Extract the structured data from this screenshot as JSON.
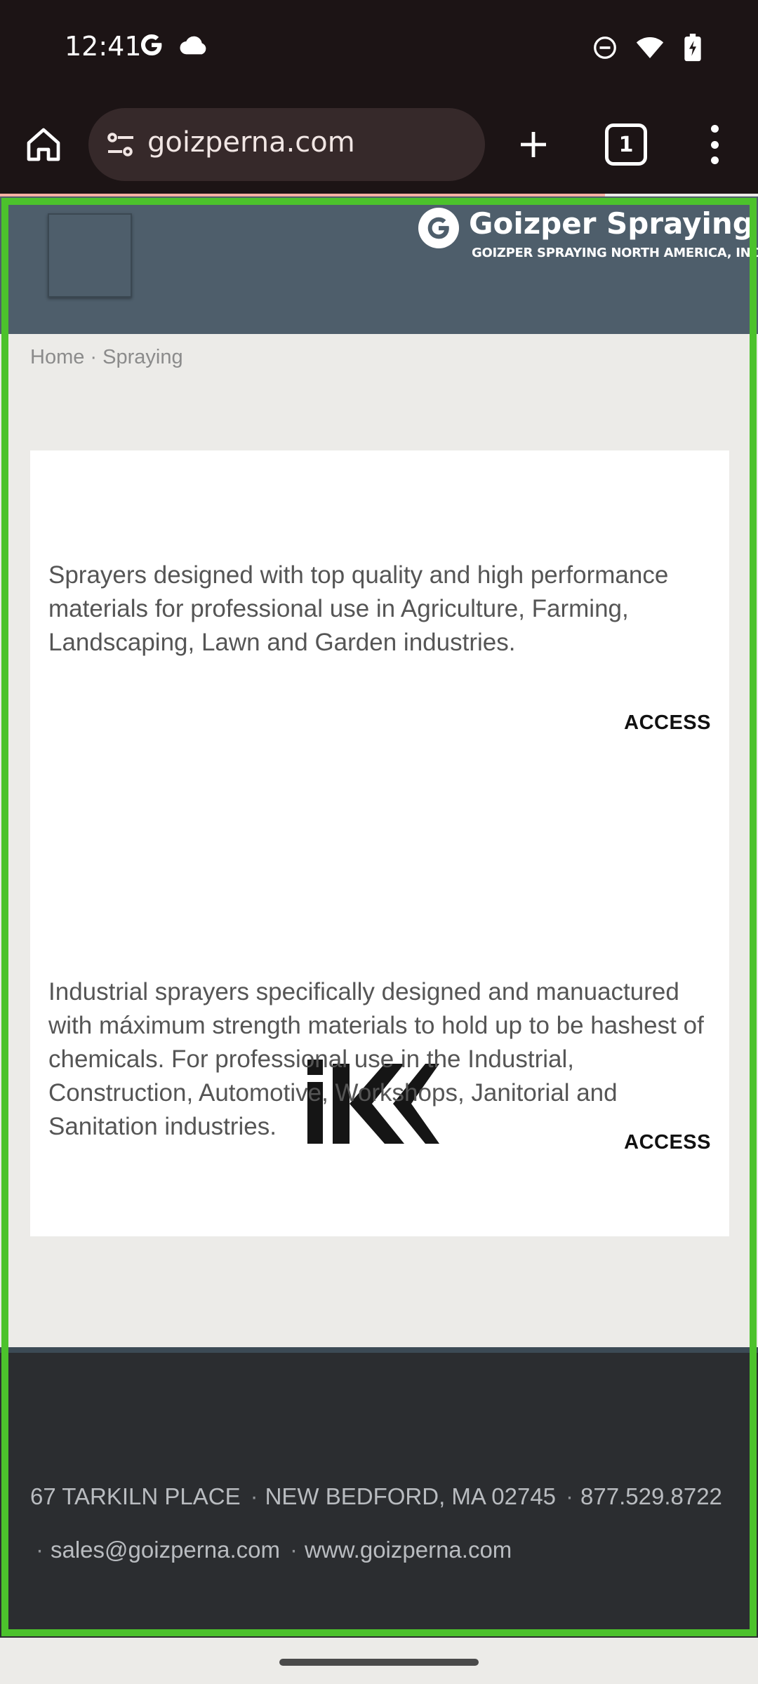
{
  "status_bar": {
    "time": "12:41",
    "left_icons": [
      "google-icon",
      "cloud-icon"
    ],
    "right_icons": [
      "do-not-disturb-icon",
      "wifi-icon",
      "battery-icon"
    ]
  },
  "browser": {
    "url": "goizperna.com",
    "tab_count": "1",
    "icons": [
      "home-icon",
      "site-settings-icon",
      "new-tab-icon",
      "tab-switcher-icon",
      "more-menu-icon"
    ]
  },
  "header": {
    "logo_title": "Goizper Spraying",
    "logo_subtitle": "GOIZPER SPRAYING NORTH AMERICA, INC."
  },
  "breadcrumb": {
    "home": "Home",
    "separator": "·",
    "current": "Spraying"
  },
  "products": [
    {
      "description": "Sprayers designed with top quality and high performance materials for professional use in Agriculture, Farming, Landscaping, Lawn and Garden industries.",
      "access_label": "ACCESS"
    },
    {
      "logo_text": "iK",
      "description": "Industrial sprayers specifically designed and manuactured with máximum strength materials to hold up to be hashest of chemicals. For professional use in the Industrial, Construction, Automotive, Workshops, Janitorial and Sanitation industries.",
      "access_label": "ACCESS"
    }
  ],
  "footer": {
    "address": "67 TARKILN PLACE",
    "city": "NEW BEDFORD, MA 02745",
    "phone": "877.529.8722",
    "email": "sales@goizperna.com",
    "website": "www.goizperna.com",
    "separator": "·"
  },
  "colors": {
    "header_bg": "#4e5e6b",
    "footer_bg": "#2b2d30",
    "highlight_frame": "#4cc22c",
    "browser_bg": "#1c1415"
  }
}
